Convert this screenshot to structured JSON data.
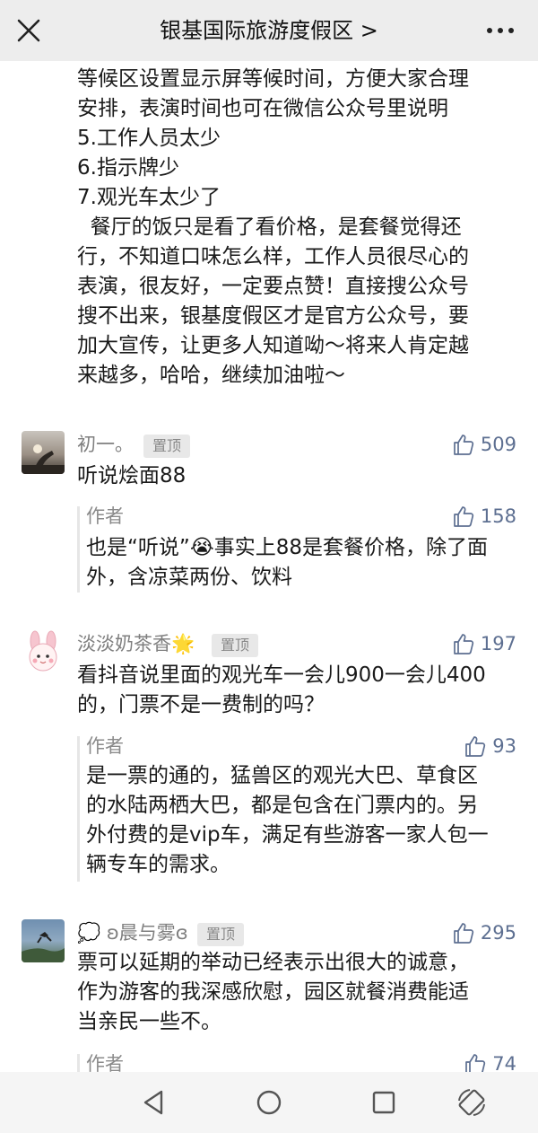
{
  "header": {
    "title": "银基国际旅游度假区 >"
  },
  "article": {
    "lines": [
      "等候区设置显示屏等候时间，方便大家合理",
      "安排，表演时间也可在微信公众号里说明",
      "5.工作人员太少",
      "6.指示牌少",
      "7.观光车太少了",
      "  餐厅的饭只是看了看价格，是套餐觉得还",
      "行，不知道口味怎么样，工作人员很尽心的",
      "表演，很友好，一定要点赞！直接搜公众号",
      "搜不出来，银基度假区才是官方公众号，要",
      "加大宣传，让更多人知道呦～将来人肯定越",
      "来越多，哈哈，继续加油啦～"
    ]
  },
  "comments": [
    {
      "nickname": "初一。",
      "pin_label": "置顶",
      "likes": "509",
      "lines": [
        "听说烩面88"
      ],
      "reply": {
        "author_label": "作者",
        "likes": "158",
        "lines": [
          "也是“听说”😭事实上88是套餐价格，除了面",
          "外，含凉菜两份、饮料"
        ]
      }
    },
    {
      "nickname": "淡淡奶茶香🌟",
      "pin_label": "置顶",
      "likes": "197",
      "lines": [
        "看抖音说里面的观光车一会儿900一会儿400",
        "的，门票不是一费制的吗？"
      ],
      "reply": {
        "author_label": "作者",
        "likes": "93",
        "lines": [
          "是一票的通的，猛兽区的观光大巴、草食区",
          "的水陆两栖大巴，都是包含在门票内的。另",
          "外付费的是vip车，满足有些游客一家人包一",
          "辆专车的需求。"
        ]
      }
    },
    {
      "nickname": "💭 ʚ晨与雾ɞ",
      "pin_label": "置顶",
      "likes": "295",
      "lines": [
        "票可以延期的举动已经表示出很大的诚意，",
        "作为游客的我深感欣慰，园区就餐消费能适",
        "当亲民一些不。"
      ],
      "reply": {
        "author_label": "作者",
        "likes": "74",
        "lines": []
      }
    }
  ]
}
